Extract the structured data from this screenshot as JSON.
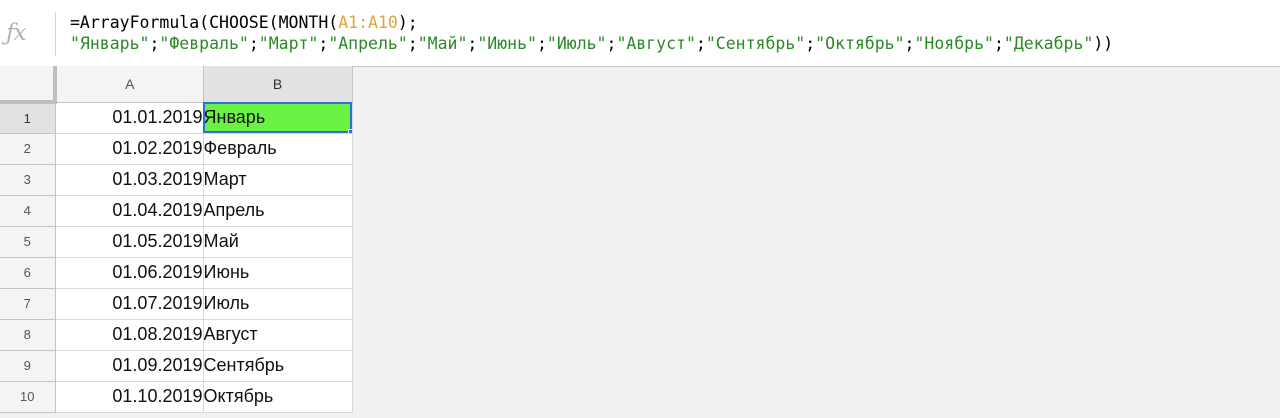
{
  "formula_bar": {
    "icon": "fx-icon",
    "line1": {
      "prefix": "=ArrayFormula(CHOOSE(MONTH(",
      "range": "A1:A10",
      "suffix": ");"
    },
    "line2": {
      "tokens": [
        {
          "text": "\"Январь\"",
          "kind": "str"
        },
        {
          "text": ";",
          "kind": "plain"
        },
        {
          "text": "\"Февраль\"",
          "kind": "str"
        },
        {
          "text": ";",
          "kind": "plain"
        },
        {
          "text": "\"Март\"",
          "kind": "str"
        },
        {
          "text": ";",
          "kind": "plain"
        },
        {
          "text": "\"Апрель\"",
          "kind": "str"
        },
        {
          "text": ";",
          "kind": "plain"
        },
        {
          "text": "\"Май\"",
          "kind": "str"
        },
        {
          "text": ";",
          "kind": "plain"
        },
        {
          "text": "\"Июнь\"",
          "kind": "str"
        },
        {
          "text": ";",
          "kind": "plain"
        },
        {
          "text": "\"Июль\"",
          "kind": "str"
        },
        {
          "text": ";",
          "kind": "plain"
        },
        {
          "text": "\"Август\"",
          "kind": "str"
        },
        {
          "text": ";",
          "kind": "plain"
        },
        {
          "text": "\"Сентябрь\"",
          "kind": "str"
        },
        {
          "text": ";",
          "kind": "plain"
        },
        {
          "text": "\"Октябрь\"",
          "kind": "str"
        },
        {
          "text": ";",
          "kind": "plain"
        },
        {
          "text": "\"Ноябрь\"",
          "kind": "str"
        },
        {
          "text": ";",
          "kind": "plain"
        },
        {
          "text": "\"Декабрь\"",
          "kind": "str"
        },
        {
          "text": "))",
          "kind": "plain"
        }
      ]
    }
  },
  "sheet": {
    "columns": [
      "A",
      "B"
    ],
    "rows": [
      {
        "num": "1",
        "a": "01.01.2019",
        "b": "Январь"
      },
      {
        "num": "2",
        "a": "01.02.2019",
        "b": "Февраль"
      },
      {
        "num": "3",
        "a": "01.03.2019",
        "b": "Март"
      },
      {
        "num": "4",
        "a": "01.04.2019",
        "b": "Апрель"
      },
      {
        "num": "5",
        "a": "01.05.2019",
        "b": "Май"
      },
      {
        "num": "6",
        "a": "01.06.2019",
        "b": "Июнь"
      },
      {
        "num": "7",
        "a": "01.07.2019",
        "b": "Июль"
      },
      {
        "num": "8",
        "a": "01.08.2019",
        "b": "Август"
      },
      {
        "num": "9",
        "a": "01.09.2019",
        "b": "Сентябрь"
      },
      {
        "num": "10",
        "a": "01.10.2019",
        "b": "Октябрь"
      }
    ],
    "active_cell": "B1",
    "active_fill_color": "#6cf243",
    "selection_color": "#2a6fd6"
  }
}
